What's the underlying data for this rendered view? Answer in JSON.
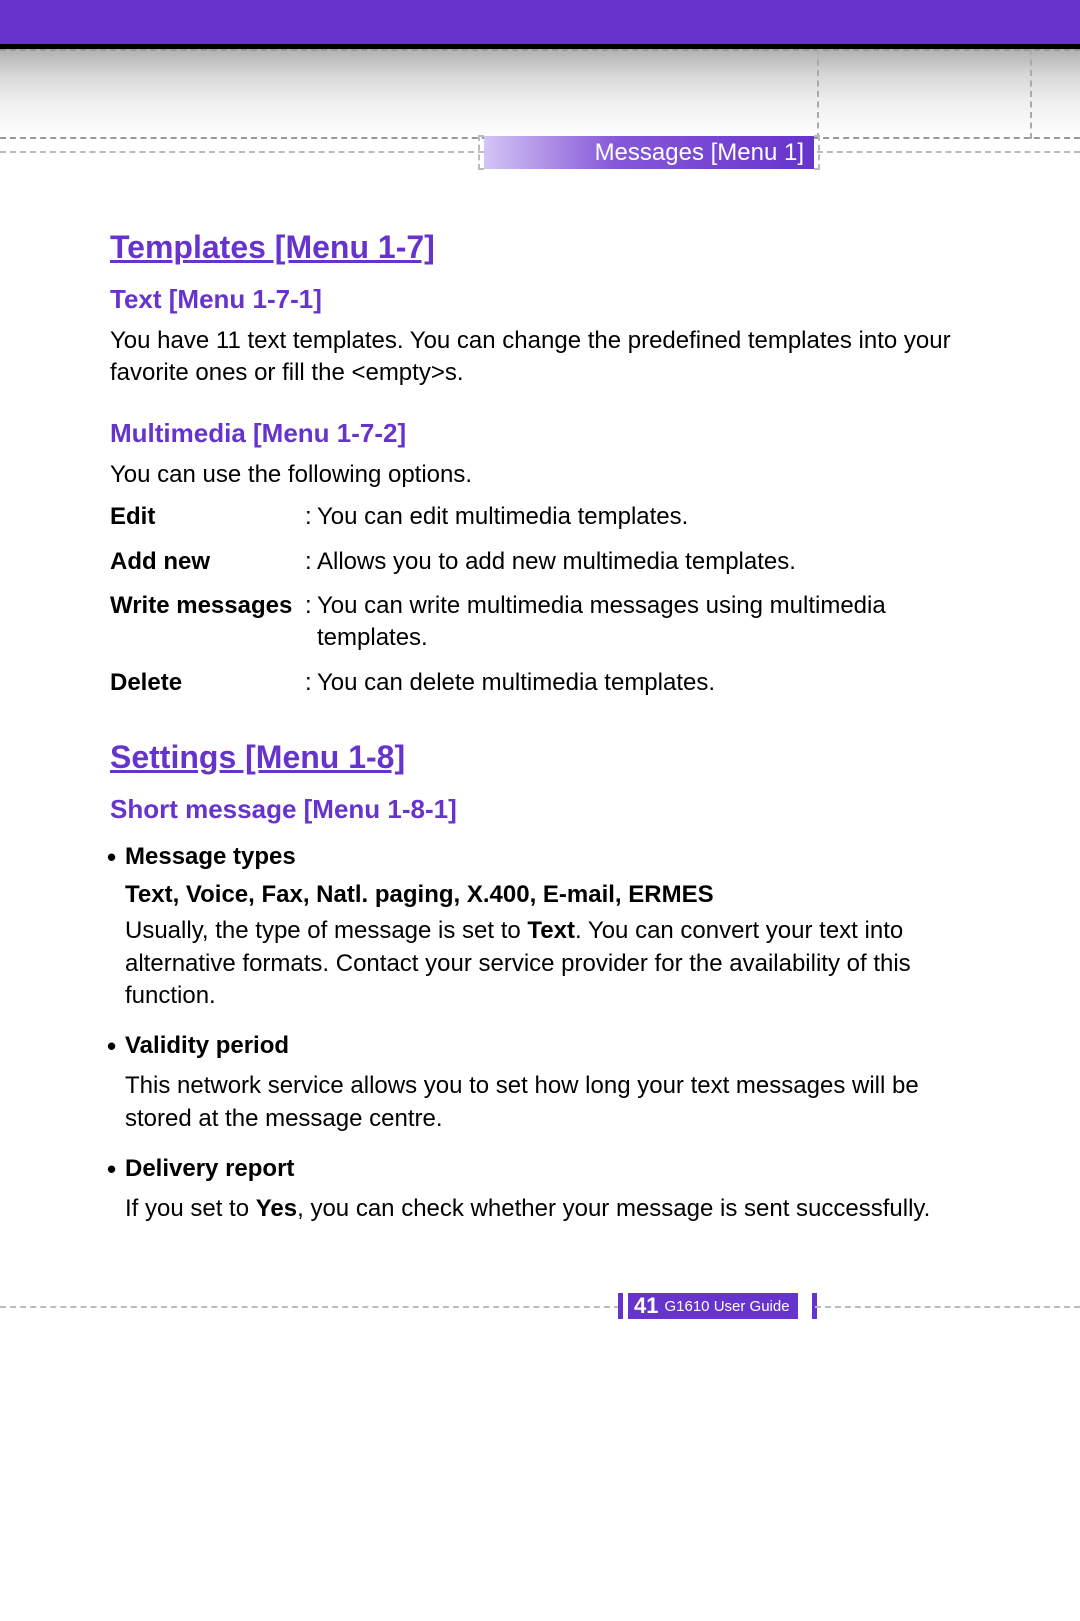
{
  "header": {
    "section_tab": "Messages [Menu 1]"
  },
  "templates": {
    "title": "Templates [Menu 1-7]",
    "text": {
      "title": "Text [Menu 1-7-1]",
      "body": "You have 11 text templates. You can change the predefined templates into your favorite ones or fill the <empty>s."
    },
    "multimedia": {
      "title": "Multimedia [Menu 1-7-2]",
      "intro": "You can use the following options.",
      "options": [
        {
          "term": "Edit",
          "desc": "You can edit multimedia templates."
        },
        {
          "term": "Add new",
          "desc": "Allows you to add new multimedia templates."
        },
        {
          "term": "Write messages",
          "desc": "You can write multimedia messages using multimedia templates."
        },
        {
          "term": "Delete",
          "desc": "You can delete multimedia templates."
        }
      ]
    }
  },
  "settings": {
    "title": "Settings [Menu 1-8]",
    "short_message": {
      "title": "Short message [Menu 1-8-1]",
      "items": [
        {
          "title": "Message types",
          "subtitle": "Text, Voice, Fax, Natl. paging, X.400, E-mail, ERMES",
          "body_pre": "Usually, the type of message is set to ",
          "body_bold": "Text",
          "body_post": ". You can convert your text into alternative formats. Contact your service provider for the availability of this function."
        },
        {
          "title": "Validity period",
          "body": "This network service allows you to set how long your text messages will be stored at the message centre."
        },
        {
          "title": "Delivery report",
          "body_pre": "If you set to ",
          "body_bold": "Yes",
          "body_post": ", you can check whether your message is sent successfully."
        }
      ]
    }
  },
  "footer": {
    "page_number": "41",
    "guide_name": "G1610 User Guide"
  }
}
